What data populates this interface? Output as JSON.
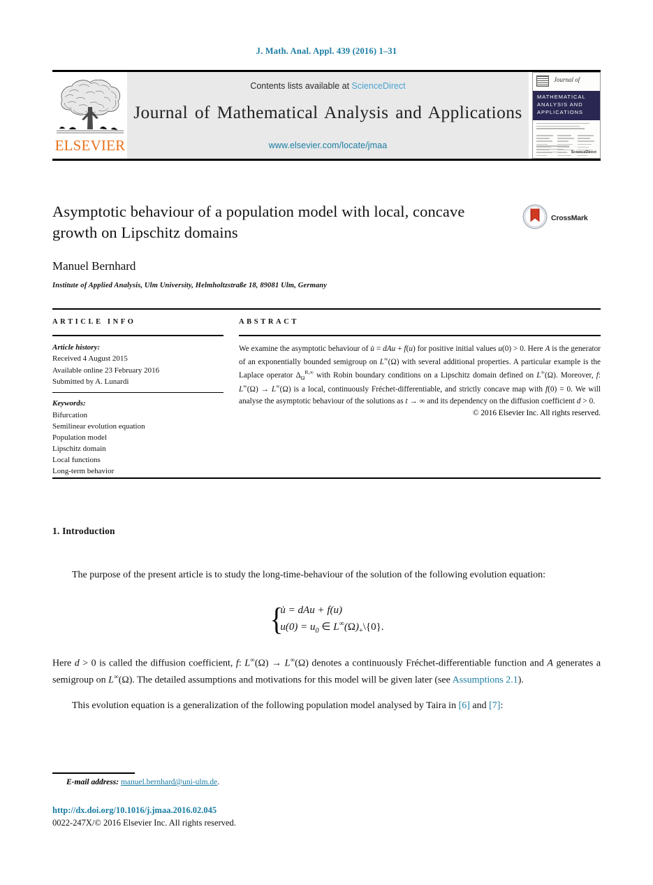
{
  "running_head": "J. Math. Anal. Appl. 439 (2016) 1–31",
  "masthead": {
    "contents_prefix": "Contents lists available at ",
    "sciencedirect_link": "ScienceDirect",
    "journal_title": "Journal of Mathematical Analysis and Applications",
    "journal_url": "www.elsevier.com/locate/jmaa",
    "publisher_wordmark": "ELSEVIER",
    "publisher_logo_icon": "elsevier-tree-icon",
    "cover": {
      "journal_of": "Journal of",
      "band_line1": "MATHEMATICAL",
      "band_line2": "ANALYSIS AND",
      "band_line3": "APPLICATIONS",
      "footer_mark": "ScienceDirect"
    }
  },
  "article": {
    "title": "Asymptotic behaviour of a population model with local, concave growth on Lipschitz domains",
    "crossmark_label": "CrossMark",
    "crossmark_icon": "crossmark-icon",
    "author": "Manuel Bernhard",
    "affiliation": "Institute of Applied Analysis, Ulm University, Helmholtzstraße 18, 89081 Ulm, Germany"
  },
  "article_info": {
    "heading": "ARTICLE INFO",
    "history_label": "Article history:",
    "history": [
      "Received 4 August 2015",
      "Available online 23 February 2016",
      "Submitted by A. Lunardi"
    ],
    "keywords_label": "Keywords:",
    "keywords": [
      "Bifurcation",
      "Semilinear evolution equation",
      "Population model",
      "Lipschitz domain",
      "Local functions",
      "Long-term behavior"
    ]
  },
  "abstract": {
    "heading": "ABSTRACT",
    "copyright": "© 2016 Elsevier Inc. All rights reserved."
  },
  "body": {
    "section_number_title": "1. Introduction",
    "para1": "The purpose of the present article is to study the long-time-behaviour of the solution of the following evolution equation:",
    "equation_line1": "u̇ = dAu + f(u)",
    "equation_line2": "u(0) = u₀ ∈ L∞(Ω)₊\\{0}.",
    "assumptions_link": "Assumptions 2.1",
    "ref6": "[6]",
    "ref7": "[7]"
  },
  "footer": {
    "email_label": "E-mail address:",
    "email_address": "manuel.bernhard@uni-ulm.de",
    "email_period": ".",
    "doi": "http://dx.doi.org/10.1016/j.jmaa.2016.02.045",
    "issn_copyright": "0022-247X/© 2016 Elsevier Inc. All rights reserved."
  },
  "colors": {
    "link_teal": "#1a7ca3",
    "link_light_blue": "#4aa3d0",
    "elsevier_orange": "#E9711C",
    "cover_band_navy": "#2a2752",
    "masthead_grey": "#e9e9e9"
  }
}
